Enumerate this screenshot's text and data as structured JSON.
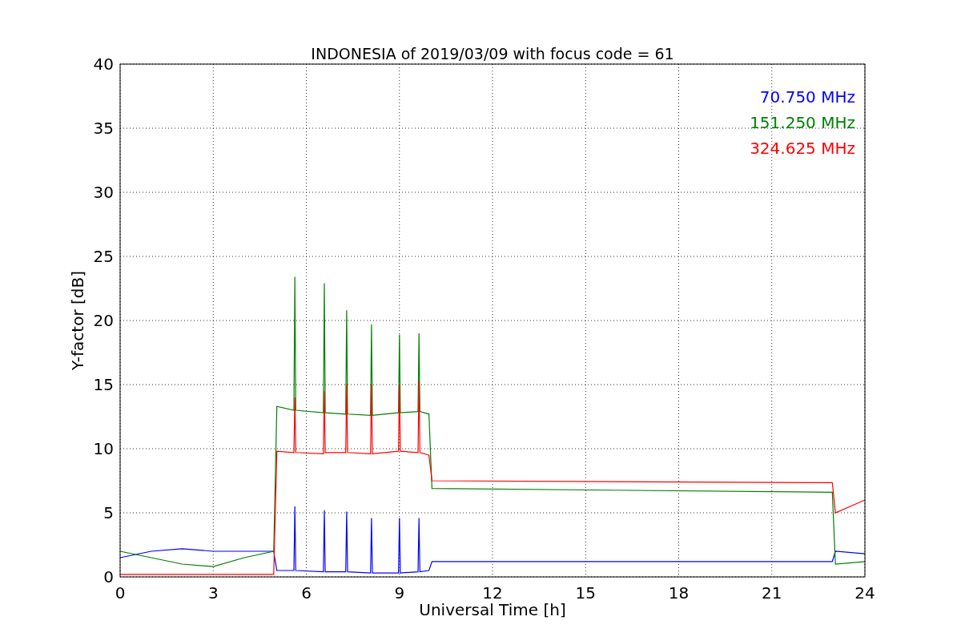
{
  "figure": {
    "chart_data": {
      "type": "line",
      "title": "INDONESIA of 2019/03/09 with focus code = 61",
      "xlabel": "Universal Time [h]",
      "ylabel": "Y-factor [dB]",
      "grid": true,
      "x": [
        0,
        1,
        2,
        3,
        4,
        4.95,
        5.05,
        5.6,
        5.63,
        5.66,
        6.55,
        6.58,
        6.61,
        7.27,
        7.3,
        7.33,
        8.07,
        8.1,
        8.13,
        8.97,
        9.0,
        9.03,
        9.6,
        9.63,
        9.66,
        9.95,
        10.05,
        22.95,
        23.05,
        24
      ],
      "series": [
        {
          "name": "70.750 MHz",
          "color": "#0000ff",
          "values": [
            1.5,
            2,
            2.2,
            2,
            2,
            2,
            0.5,
            0.5,
            5.5,
            0.5,
            0.4,
            5.2,
            0.4,
            0.4,
            5.1,
            0.4,
            0.3,
            4.6,
            0.3,
            0.3,
            4.6,
            0.3,
            0.4,
            4.6,
            0.4,
            0.5,
            1.2,
            1.2,
            2,
            1.8
          ]
        },
        {
          "name": "151.250 MHz",
          "color": "#008000",
          "values": [
            2,
            1.5,
            1,
            0.8,
            1.5,
            2,
            13.3,
            13,
            23.4,
            13,
            12.8,
            22.9,
            12.8,
            12.7,
            20.8,
            12.7,
            12.6,
            19.7,
            12.6,
            12.8,
            18.9,
            12.8,
            12.9,
            19,
            12.9,
            12.7,
            6.9,
            6.6,
            1,
            1.2
          ]
        },
        {
          "name": "324.625 MHz",
          "color": "#ff0000",
          "values": [
            0.2,
            0.2,
            0.2,
            0.2,
            0.2,
            0.2,
            9.8,
            9.7,
            14,
            9.7,
            9.6,
            14.5,
            9.7,
            9.7,
            15,
            9.7,
            9.6,
            15,
            9.6,
            9.8,
            15,
            9.8,
            9.7,
            15.3,
            9.7,
            9.5,
            7.5,
            7.35,
            5,
            6
          ]
        }
      ],
      "xlim": [
        0,
        24
      ],
      "ylim": [
        0,
        40
      ],
      "xticks": [
        0,
        3,
        6,
        9,
        12,
        15,
        18,
        21,
        24
      ],
      "yticks": [
        0,
        5,
        10,
        15,
        20,
        25,
        30,
        35,
        40
      ]
    }
  }
}
